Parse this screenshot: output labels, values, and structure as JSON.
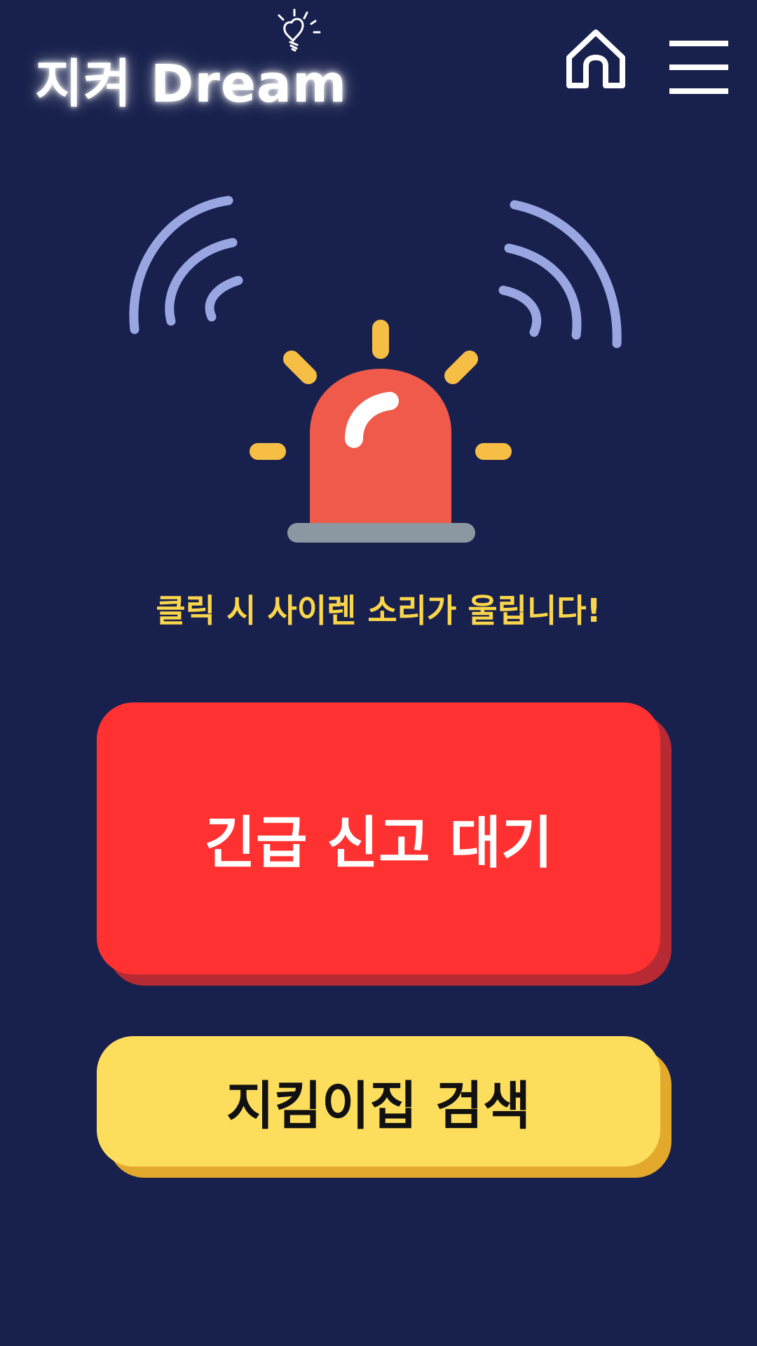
{
  "header": {
    "logo_text": "지켜 Dream",
    "home_icon": "home-icon",
    "menu_icon": "hamburger-menu-icon"
  },
  "siren": {
    "icon": "siren-icon",
    "notice": "클릭 시 사이렌 소리가 울립니다!"
  },
  "buttons": {
    "emergency_label": "긴급 신고 대기",
    "search_label": "지킴이집 검색"
  },
  "colors": {
    "background": "#18214d",
    "notice_text": "#fbd64a",
    "emergency_button": "#ff3131",
    "search_button": "#fddd5c",
    "siren_body": "#f05a4a",
    "siren_rays": "#f7be45",
    "sound_waves": "#9aa6e2"
  }
}
